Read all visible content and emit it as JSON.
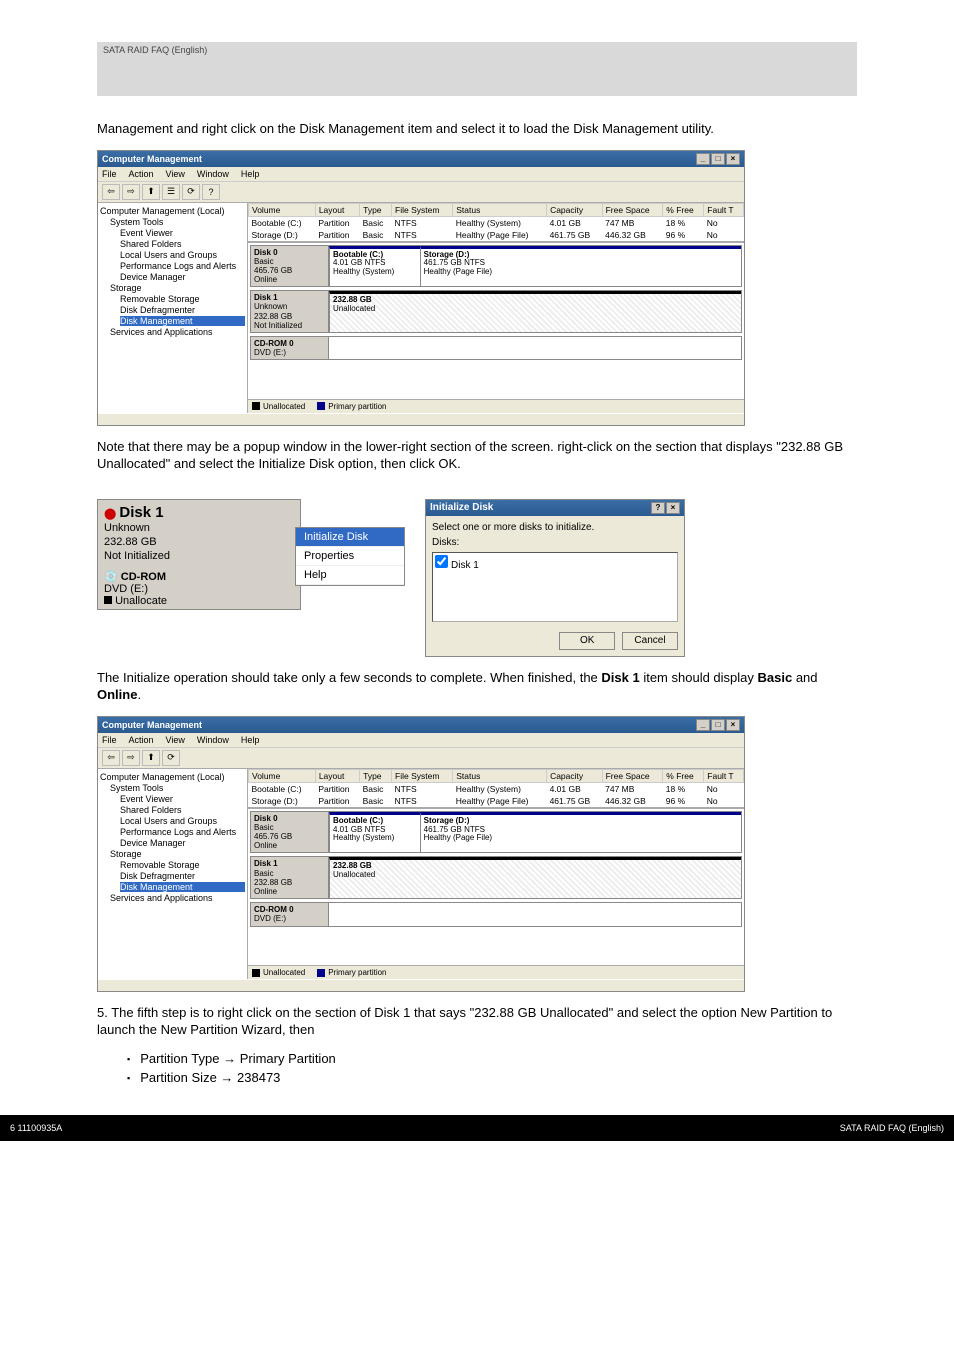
{
  "header": {
    "label": "SATA RAID FAQ (English)"
  },
  "intro_text": "Management and right click on the Disk Management item and select it to load the Disk Management utility.",
  "win": {
    "title": "Computer Management",
    "menus": [
      "File",
      "Action",
      "View",
      "Window",
      "Help"
    ],
    "tree": {
      "root": "Computer Management (Local)",
      "system_tools": "System Tools",
      "event_viewer": "Event Viewer",
      "shared_folders": "Shared Folders",
      "local_users": "Local Users and Groups",
      "perf_logs": "Performance Logs and Alerts",
      "device_mgr": "Device Manager",
      "storage": "Storage",
      "removable": "Removable Storage",
      "defrag": "Disk Defragmenter",
      "disk_mgmt": "Disk Management",
      "services": "Services and Applications"
    },
    "columns": [
      "Volume",
      "Layout",
      "Type",
      "File System",
      "Status",
      "Capacity",
      "Free Space",
      "% Free",
      "Fault T"
    ],
    "rows": [
      {
        "vol": "Bootable (C:)",
        "layout": "Partition",
        "type": "Basic",
        "fs": "NTFS",
        "status": "Healthy (System)",
        "cap": "4.01 GB",
        "free": "747 MB",
        "pct": "18 %",
        "fault": "No"
      },
      {
        "vol": "Storage (D:)",
        "layout": "Partition",
        "type": "Basic",
        "fs": "NTFS",
        "status": "Healthy (Page File)",
        "cap": "461.75 GB",
        "free": "446.32 GB",
        "pct": "96 %",
        "fault": "No"
      }
    ],
    "disks": [
      {
        "name": "Disk 0",
        "kind": "Basic",
        "size": "465.76 GB",
        "state": "Online",
        "parts": [
          {
            "label": "Bootable (C:)",
            "line2": "4.01 GB NTFS",
            "line3": "Healthy (System)",
            "w": "22%"
          },
          {
            "label": "Storage (D:)",
            "line2": "461.75 GB NTFS",
            "line3": "Healthy (Page File)",
            "w": "78%"
          }
        ]
      },
      {
        "name": "Disk 1",
        "kind": "Unknown",
        "size": "232.88 GB",
        "state": "Not Initialized",
        "parts": [
          {
            "label": "232.88 GB",
            "line2": "Unallocated",
            "line3": "",
            "w": "100%",
            "unalloc": true
          }
        ]
      },
      {
        "name": "CD-ROM 0",
        "kind": "DVD (E:)",
        "size": "",
        "state": "",
        "parts": []
      }
    ],
    "legend": {
      "unalloc": "Unallocated",
      "primary": "Primary partition"
    }
  },
  "para2": "Note that there may be a popup window in the lower-right section of the screen. right-click on the section that displays \"232.88 GB Unallocated\" and select the Initialize Disk option, then click OK.",
  "ctx": {
    "disk1": {
      "name": "Disk 1",
      "kind": "Unknown",
      "size": "232.88 GB",
      "state": "Not Initialized"
    },
    "menu": [
      "Initialize Disk",
      "Properties",
      "Help"
    ],
    "cdrom": "CD-ROM",
    "dvd": "DVD (E:)",
    "unalloc": "Unallocate"
  },
  "dialog": {
    "title": "Initialize Disk",
    "instr": "Select one or more disks to initialize.",
    "label": "Disks:",
    "item": "Disk 1",
    "ok": "OK",
    "cancel": "Cancel"
  },
  "win2_caption_pre": "The Initialize operation should take only a few seconds to complete. When finished, the ",
  "win2_caption_mid": "Disk 1",
  "win2_caption_post": " item should display ",
  "win2_caption_basic": "Basic",
  "win2_caption_and": " and ",
  "win2_caption_online": "Online",
  "win2_caption_end": ".",
  "win2": {
    "disks": [
      {
        "name": "Disk 0",
        "kind": "Basic",
        "size": "465.76 GB",
        "state": "Online",
        "parts": [
          {
            "label": "Bootable (C:)",
            "line2": "4.01 GB NTFS",
            "line3": "Healthy (System)",
            "w": "22%"
          },
          {
            "label": "Storage (D:)",
            "line2": "461.75 GB NTFS",
            "line3": "Healthy (Page File)",
            "w": "78%"
          }
        ]
      },
      {
        "name": "Disk 1",
        "kind": "Basic",
        "size": "232.88 GB",
        "state": "Online",
        "parts": [
          {
            "label": "232.88 GB",
            "line2": "Unallocated",
            "line3": "",
            "w": "100%",
            "unalloc": true
          }
        ]
      },
      {
        "name": "CD-ROM 0",
        "kind": "DVD (E:)",
        "size": "",
        "state": "",
        "parts": []
      }
    ]
  },
  "step5": {
    "lead": "5. The fifth step is to right click on the section of Disk 1 that says \"232.88 GB Unallocated\" and select the option New Partition to launch the New Partition Wizard, then",
    "b1a": "Partition Type ",
    "b1b": "Primary Partition",
    "b2a": "Partition Size ",
    "b2b": "238473"
  },
  "footer": {
    "left": "6 11100935A",
    "right": "SATA RAID FAQ (English)"
  }
}
